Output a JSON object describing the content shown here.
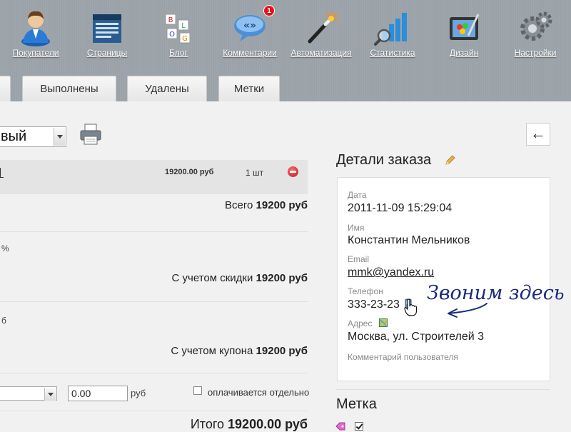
{
  "nav": {
    "items": [
      {
        "label": "Покупатели"
      },
      {
        "label": "Страницы"
      },
      {
        "label": "Блог"
      },
      {
        "label": "Комментарии",
        "badge": "1"
      },
      {
        "label": "Автоматизация"
      },
      {
        "label": "Статистика"
      },
      {
        "label": "Дизайн"
      },
      {
        "label": "Настройки"
      }
    ]
  },
  "tabs": [
    "Выполнены",
    "Удалены",
    "Метки"
  ],
  "order": {
    "status_value": "вый",
    "product": {
      "price": "19200.00 руб",
      "qty": "1 шт"
    },
    "fragments": {
      "percent": "%",
      "rub": "б"
    },
    "total_label": "Всего",
    "total_value": "19200 руб",
    "discount_label": "С учетом скидки",
    "discount_value": "19200 руб",
    "coupon_label": "С учетом купона",
    "coupon_value": "19200 руб",
    "delivery_cost": "0.00",
    "currency": "руб",
    "separate_label": "оплачивается отдельно",
    "grand_label": "Итого",
    "grand_value": "19200.00 руб"
  },
  "details": {
    "back_arrow": "←",
    "title": "Детали заказа",
    "date_label": "Дата",
    "date_value": "2011-11-09 15:29:04",
    "name_label": "Имя",
    "name_value": "Константин Мельников",
    "email_label": "Email",
    "email_value": "mmk@yandex.ru",
    "phone_label": "Телефон",
    "phone_value": "333-23-23",
    "address_label": "Адрес",
    "address_value": "Москва, ул. Строителей 3",
    "comment_label": "Комментарий пользователя",
    "annotation": "Звоним здесь"
  },
  "mark": {
    "title": "Метка",
    "checked": true
  },
  "colors": {
    "topbar": "#9ea5ac",
    "badge": "#e2141b",
    "annotation_ink": "#1a2a7c"
  }
}
